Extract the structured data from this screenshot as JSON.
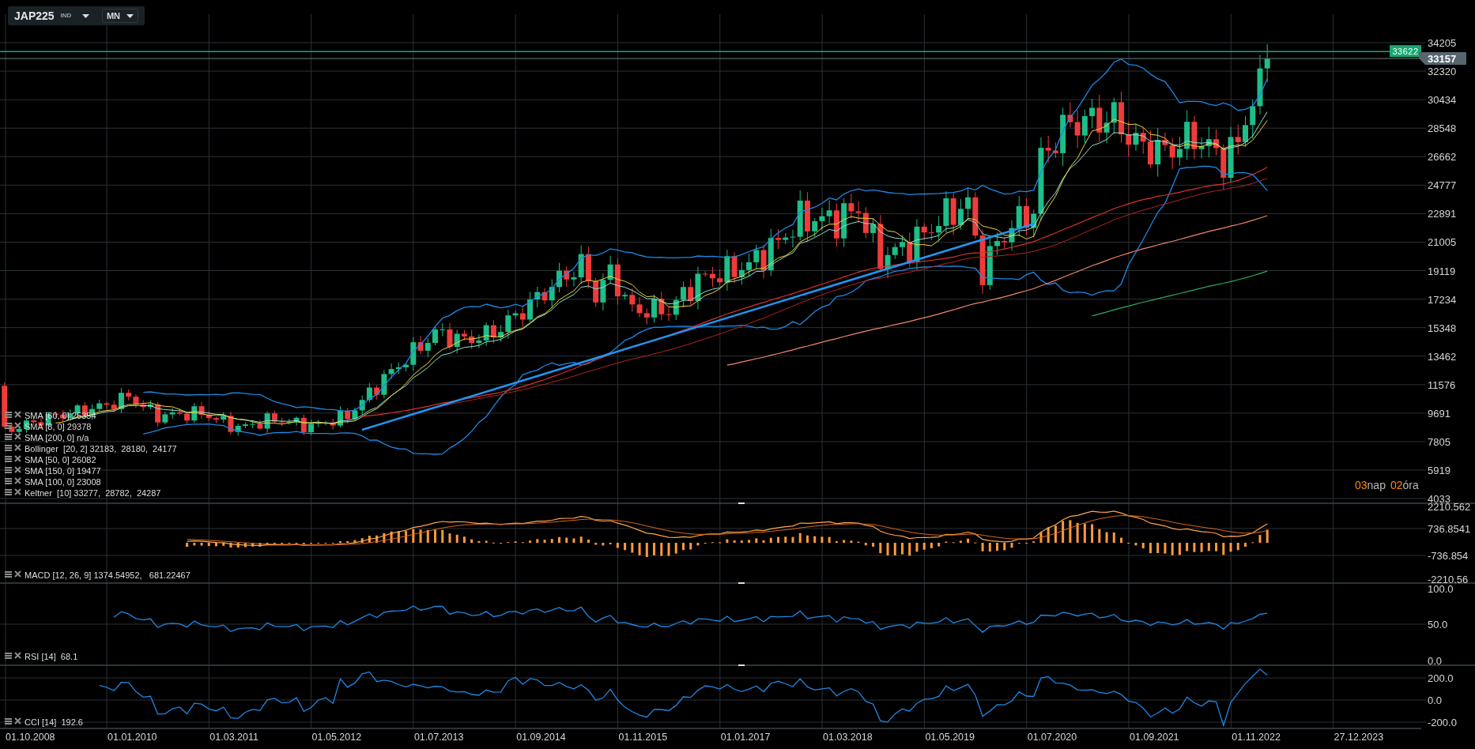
{
  "toolbar": {
    "symbol": "JAP225",
    "market": "IND",
    "timeframe": "MN"
  },
  "price_axis": {
    "ticks": [
      "34205",
      "32320",
      "30434",
      "28548",
      "26662",
      "24777",
      "22891",
      "21005",
      "19119",
      "17234",
      "15348",
      "13462",
      "11576",
      "9691",
      "7805",
      "5919",
      "4033"
    ]
  },
  "price_tags": [
    {
      "kind": "ask",
      "label": "33622",
      "color": "#16a870"
    },
    {
      "kind": "last",
      "label": "33157",
      "color": "#56656e"
    }
  ],
  "countdown": [
    {
      "value": "03",
      "unit": "nap"
    },
    {
      "value": "02",
      "unit": "óra"
    }
  ],
  "indicators": [
    {
      "label": "SMA [60, 0] 25354"
    },
    {
      "label": "SMA [8, 0] 29378"
    },
    {
      "label": "SMA [200, 0] n/a"
    },
    {
      "label": "Bollinger  [20, 2] 32183,  28180,  24177"
    },
    {
      "label": "SMA [50, 0] 26082"
    },
    {
      "label": "SMA [150, 0] 19477"
    },
    {
      "label": "SMA [100, 0] 23008"
    },
    {
      "label": "Keltner  [10] 33277,  28782,  24287"
    }
  ],
  "panes": [
    {
      "kind": "macd",
      "label": "MACD [12, 26, 9] 1374.54952,   681.22467",
      "ticks": [
        "2210.562",
        "736.8541",
        "-736.854",
        "-2210.56"
      ]
    },
    {
      "kind": "rsi",
      "label": "RSI [14]  68.1",
      "ticks": [
        "100.0",
        "50.0",
        "0.0"
      ]
    },
    {
      "kind": "cci",
      "label": "CCI [14]  192.6",
      "ticks": [
        "200.0",
        "0.0",
        "-200.0"
      ]
    }
  ],
  "time_axis": {
    "labels": [
      "01.10.2008",
      "01.01.2010",
      "01.03.2011",
      "01.05.2012",
      "01.07.2013",
      "01.09.2014",
      "01.11.2015",
      "01.01.2017",
      "01.03.2018",
      "01.05.2019",
      "01.07.2020",
      "01.09.2021",
      "01.11.2022",
      "27.12.2023"
    ]
  }
}
